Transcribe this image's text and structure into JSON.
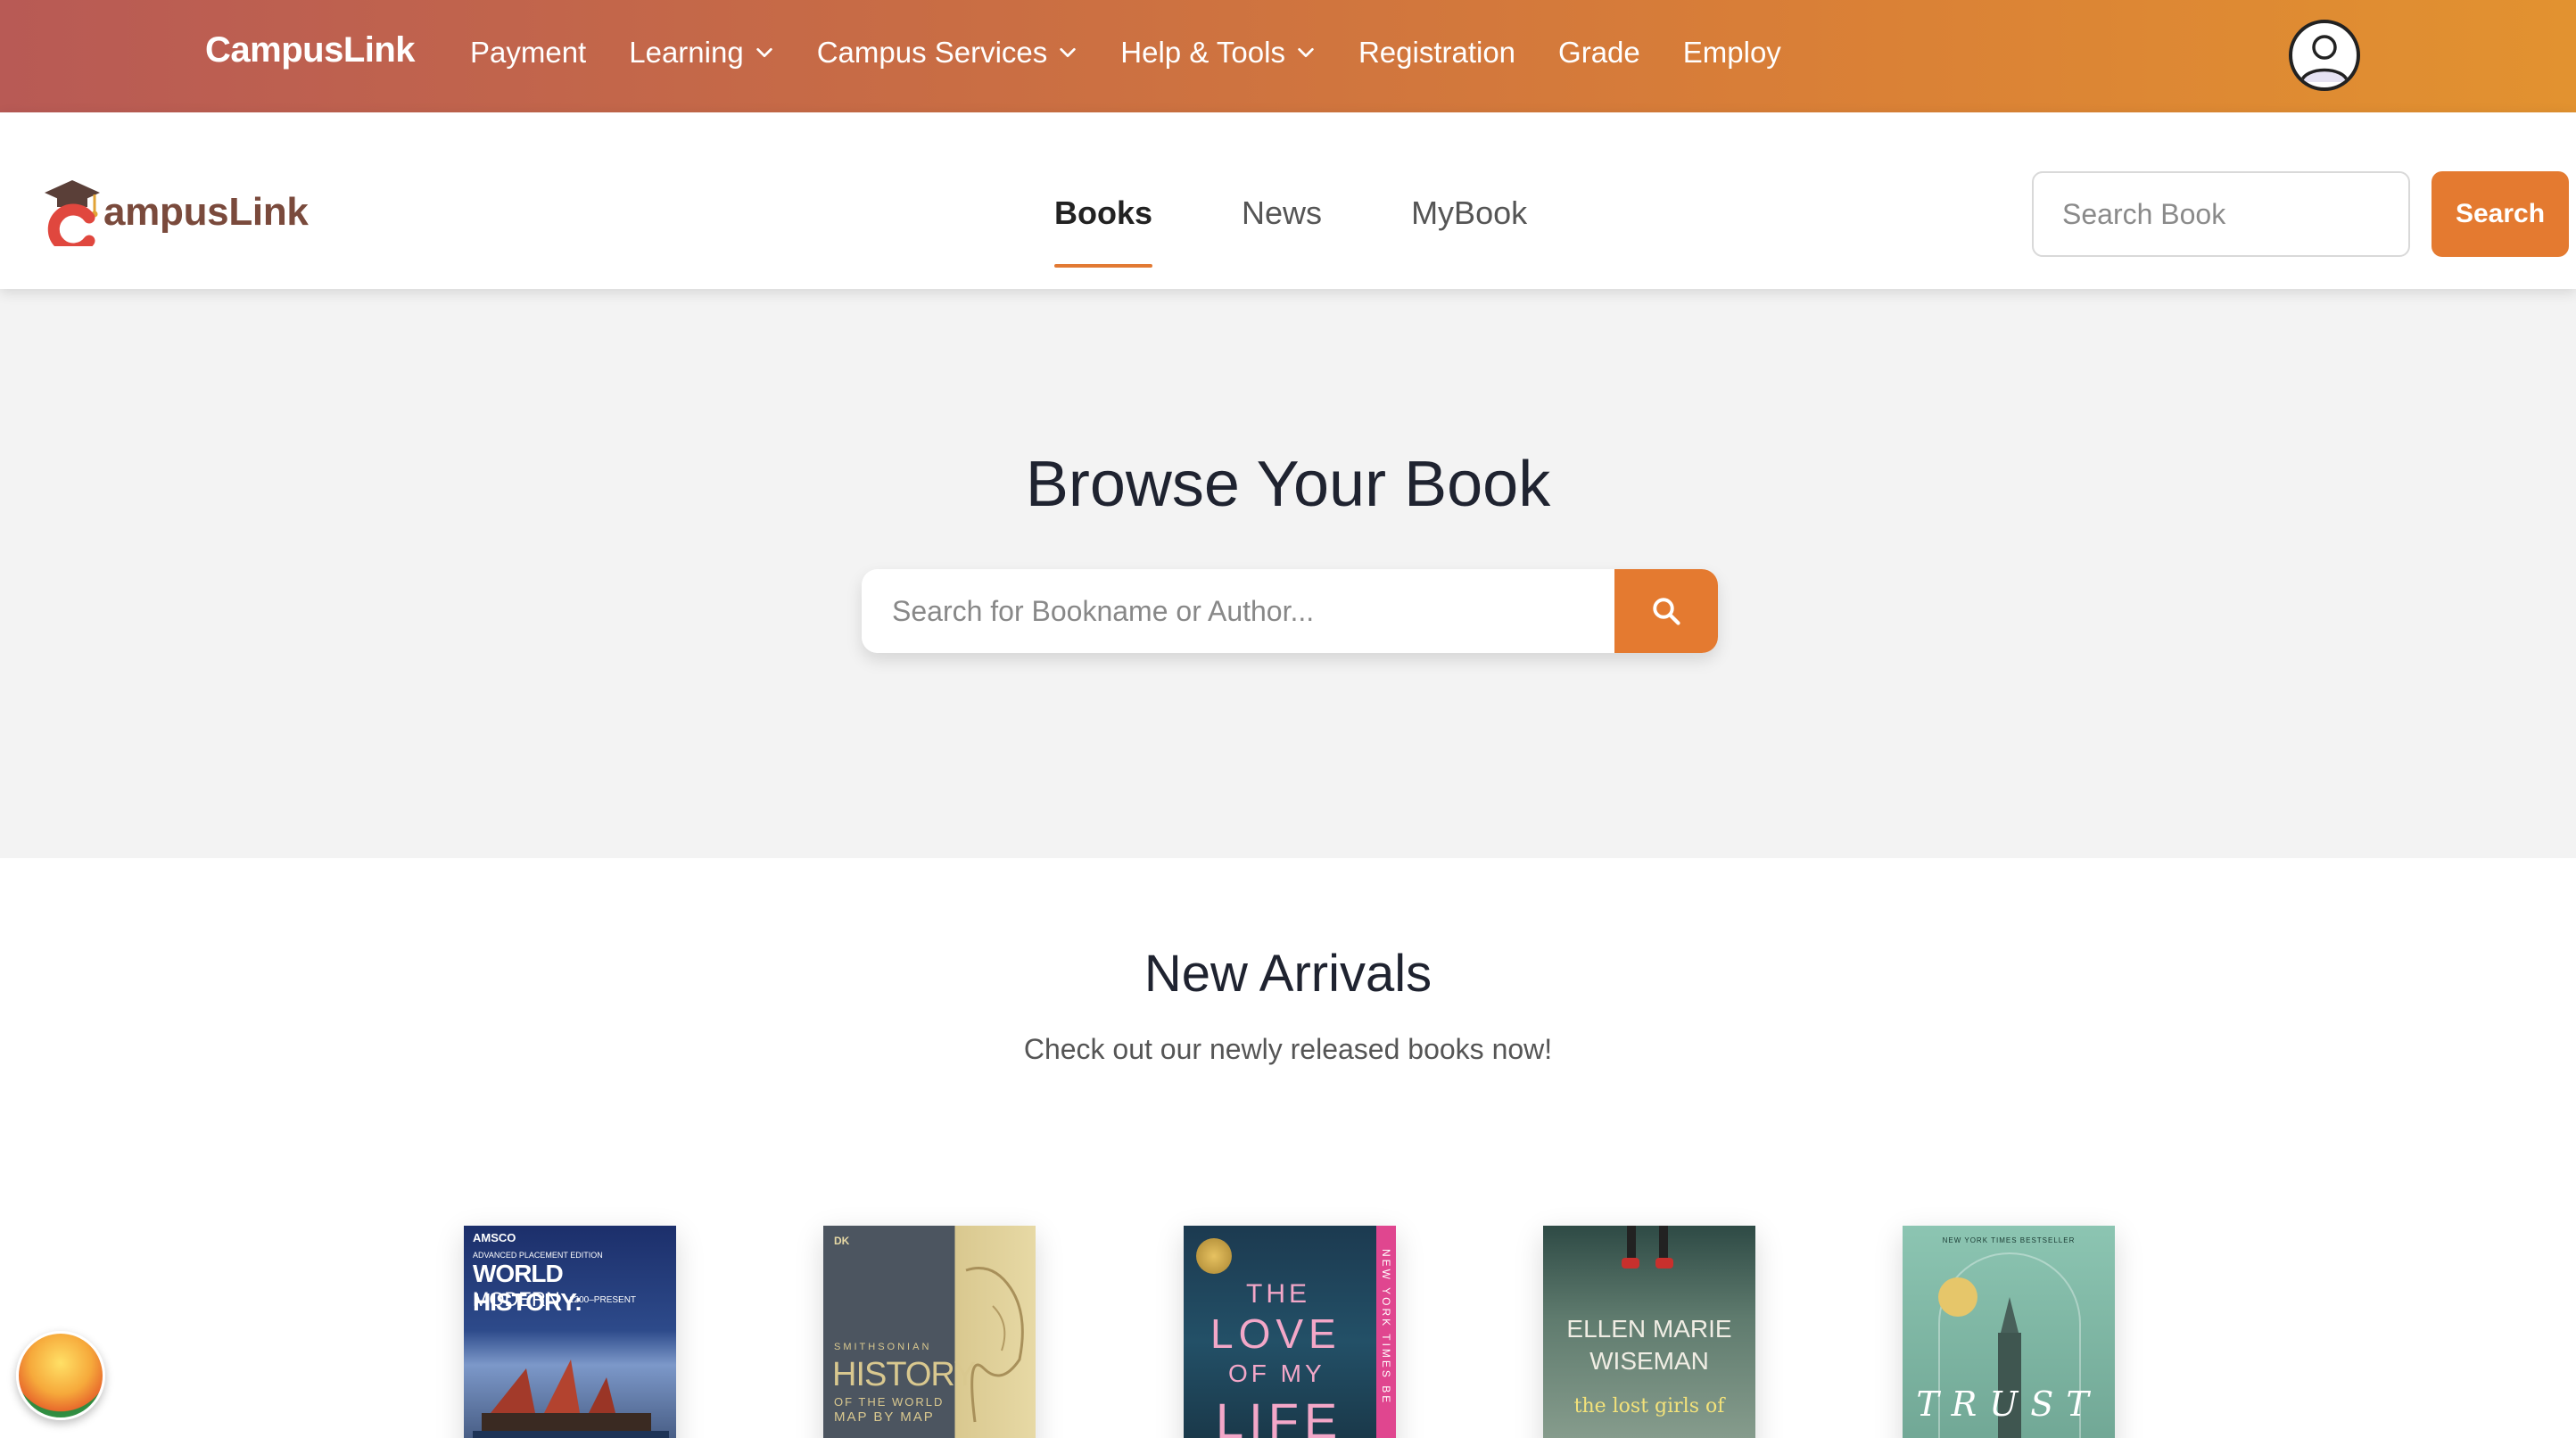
{
  "topbar": {
    "brand": "CampusLink",
    "nav": [
      {
        "label": "Payment",
        "dropdown": false
      },
      {
        "label": "Learning",
        "dropdown": true
      },
      {
        "label": "Campus Services",
        "dropdown": true
      },
      {
        "label": "Help & Tools",
        "dropdown": true
      },
      {
        "label": "Registration",
        "dropdown": false
      },
      {
        "label": "Grade",
        "dropdown": false
      },
      {
        "label": "Employ",
        "dropdown": false
      }
    ],
    "avatar_icon": "user-avatar-icon"
  },
  "header": {
    "logo_text": "ampusLink",
    "logo_letter": "C",
    "tabs": [
      {
        "label": "Books",
        "active": true
      },
      {
        "label": "News",
        "active": false
      },
      {
        "label": "MyBook",
        "active": false
      }
    ],
    "search_placeholder": "Search Book",
    "search_button": "Search"
  },
  "hero": {
    "title": "Browse Your Book",
    "search_placeholder": "Search for Bookname or Author...",
    "search_icon": "search-icon"
  },
  "arrivals": {
    "title": "New Arrivals",
    "subtitle": "Check out our newly released books now!",
    "books": [
      {
        "cover_lines": [
          "AMSCO",
          "ADVANCED PLACEMENT EDITION",
          "WORLD HISTORY:",
          "MODERN",
          "1200–PRESENT"
        ]
      },
      {
        "cover_lines": [
          "DK",
          "SMITHSONIAN",
          "HISTORY",
          "OF THE WORLD",
          "MAP BY MAP"
        ]
      },
      {
        "cover_lines": [
          "THE",
          "LOVE",
          "OF MY",
          "LIFE",
          "NEW YORK TIMES BE"
        ]
      },
      {
        "cover_lines": [
          "ELLEN MARIE",
          "WISEMAN",
          "the lost girls of"
        ]
      },
      {
        "cover_lines": [
          "NEW YORK TIMES BESTSELLER",
          "TRUST"
        ]
      }
    ]
  },
  "colors": {
    "accent": "#e47a30",
    "topbar_start": "#b85a55",
    "topbar_end": "#e29230",
    "hero_bg": "#f3f3f3"
  }
}
